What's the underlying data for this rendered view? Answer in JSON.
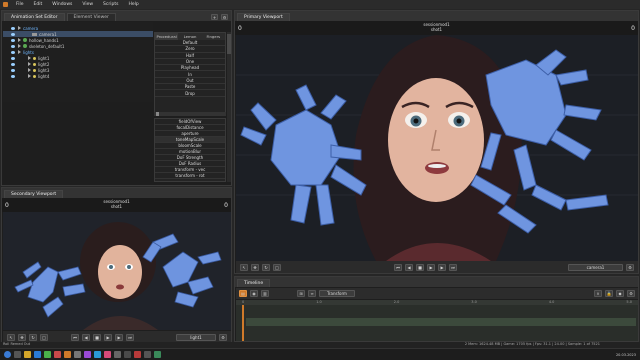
{
  "menubar": {
    "items": [
      "File",
      "Edit",
      "Windows",
      "View",
      "Scripts",
      "Help"
    ]
  },
  "left_panel": {
    "tabs": [
      "Animation Set Editor",
      "Element Viewer"
    ],
    "tree": [
      {
        "label": "camera",
        "icon": "camera-icon",
        "indent": 1,
        "selected": true
      },
      {
        "label": "camera1",
        "icon": "camera-icon",
        "indent": 2,
        "selected": false
      },
      {
        "label": "hollow_hands1",
        "icon": "model-icon",
        "indent": 1,
        "selected": false
      },
      {
        "label": "skeleton_default1",
        "icon": "model-icon",
        "indent": 1,
        "selected": false
      },
      {
        "label": "lights",
        "icon": "folder-icon",
        "indent": 1,
        "selected": false
      },
      {
        "label": "light1",
        "icon": "light-icon",
        "indent": 2,
        "selected": false
      },
      {
        "label": "light2",
        "icon": "light-icon",
        "indent": 2,
        "selected": false
      },
      {
        "label": "light3",
        "icon": "light-icon",
        "indent": 2,
        "selected": false
      },
      {
        "label": "light4",
        "icon": "light-icon",
        "indent": 2,
        "selected": false
      }
    ]
  },
  "preset_panel": {
    "tabs": [
      "Procedural",
      "Lemon",
      "Fingers"
    ],
    "items": [
      "Default",
      "Zero",
      "Half",
      "One",
      "Playhead",
      "In",
      "Out",
      "Paste",
      "Drop"
    ],
    "controls": [
      "fieldOfView",
      "focalDistance",
      "aperture",
      "toneMapScale",
      "bloomScale",
      "motionBlur",
      "DoF Strength",
      "DoF Radius",
      "transform - vec",
      "transform - rot"
    ]
  },
  "primary_viewport": {
    "tab": "Primary Viewport",
    "camera_name": "sessionmod1",
    "shot_name": "shot1",
    "frame_label": "0",
    "right_label": "0",
    "camera_button": "camera1"
  },
  "secondary_viewport": {
    "tab": "Secondary Viewport",
    "camera_name": "sessionmod1",
    "shot_name": "shot1",
    "frame_label": "0",
    "right_label": "0",
    "light_button": "light1"
  },
  "timeline": {
    "tab": "Timeline",
    "transform_label": "Transform",
    "ruler_labels": [
      "0",
      "1.0",
      "2.0",
      "3.0",
      "4.0",
      "5.0"
    ]
  },
  "status": {
    "left": "Roll Remed Out",
    "right": "2 Mem: 1624.48 MB | Game: 1705 fps | Fps: 31.1 | 24.00 | Sample: 1 of 7521",
    "time": "20.03.2023"
  },
  "colors": {
    "accent_orange": "#d07a2a",
    "hand_blue": "#6e94df",
    "bg_dark": "#1e1e1e"
  }
}
